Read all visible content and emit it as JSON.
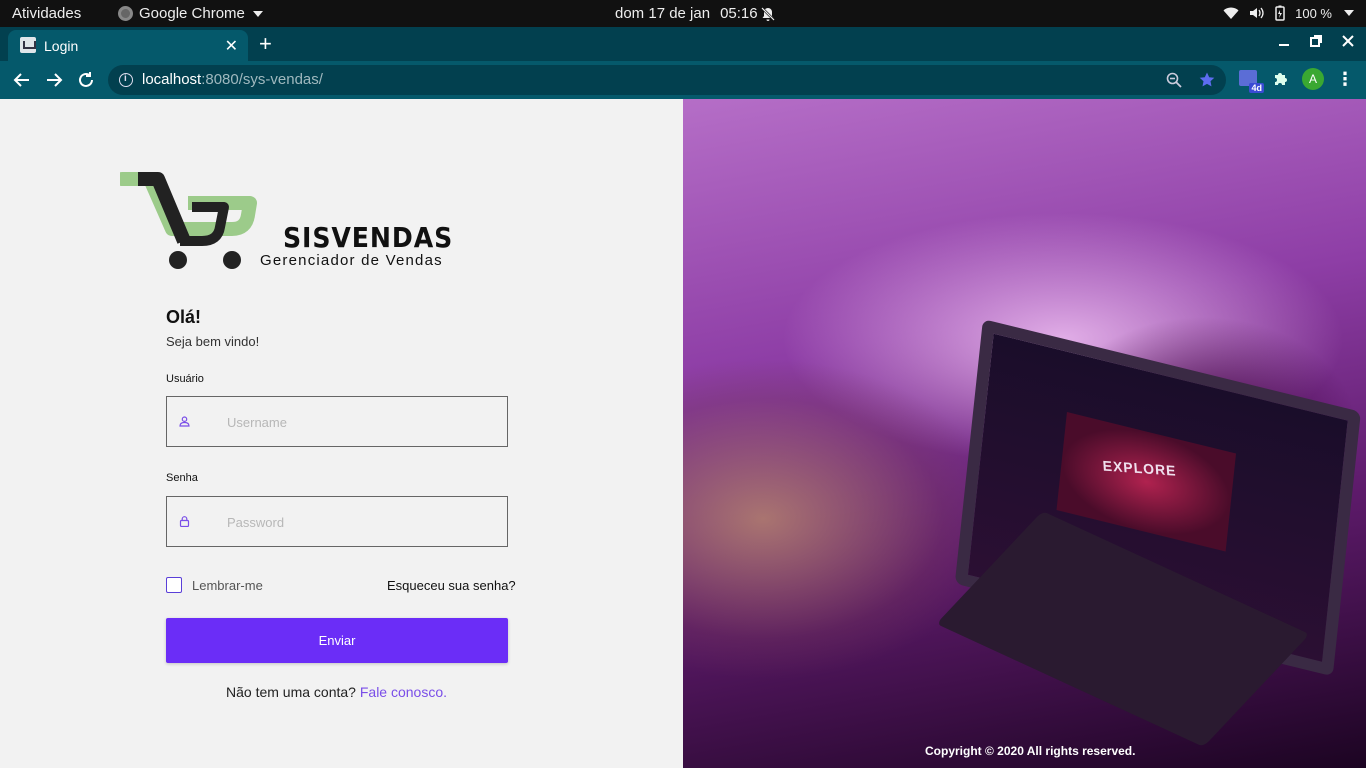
{
  "system_bar": {
    "activities": "Atividades",
    "app_name": "Google Chrome",
    "date": "dom 17 de jan",
    "time": "05:16",
    "battery": "100 %"
  },
  "browser": {
    "tab_title": "Login",
    "tab_close": "✕",
    "new_tab": "+",
    "url_host": "localhost",
    "url_rest": ":8080/sys-vendas/",
    "extension_badge": "4d",
    "profile_initial": "A",
    "menu": "⋮"
  },
  "login": {
    "brand": "SISVENDAS",
    "tagline": "Gerenciador de Vendas",
    "greeting": "Olá!",
    "welcome": "Seja bem vindo!",
    "username_label": "Usuário",
    "username_placeholder": "Username",
    "password_label": "Senha",
    "password_placeholder": "Password",
    "remember_label": "Lembrar-me",
    "forgot_link": "Esqueceu sua senha?",
    "submit_label": "Enviar",
    "signup_prompt": "Não tem uma conta?",
    "signup_link": "Fale conosco."
  },
  "hero": {
    "screen_text": "EXPLORE",
    "copyright": "Copyright © 2020 All rights reserved."
  },
  "colors": {
    "accent": "#6b2df7",
    "link": "#7a4ee8",
    "chrome_frame": "#02404f",
    "chrome_toolbar": "#05596b",
    "logo_green": "#9ccb8a"
  },
  "icons": {
    "username_field": "user-icon",
    "password_field": "lock-icon",
    "bookmark": "star-icon",
    "extensions": "puzzle-icon"
  }
}
